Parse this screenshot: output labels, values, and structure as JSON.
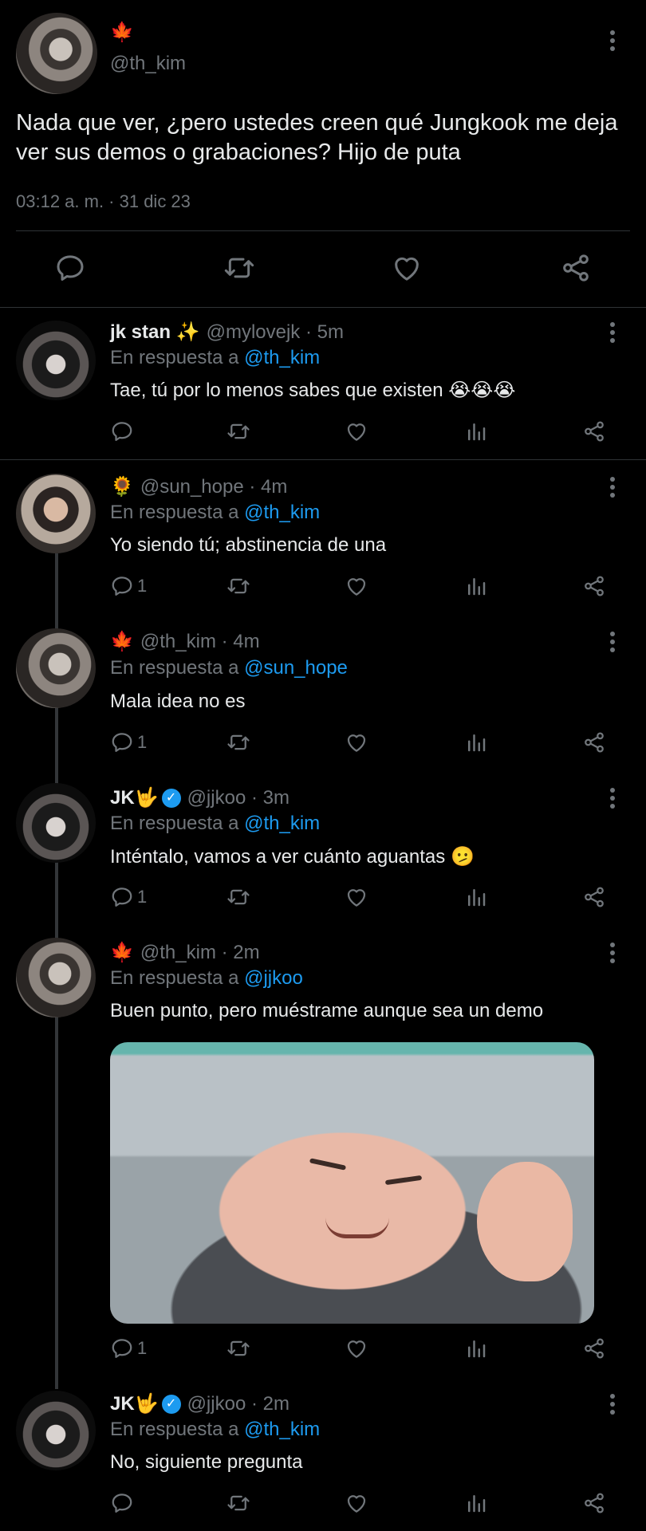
{
  "main_tweet": {
    "author_emoji": "🍁",
    "handle": "@th_kim",
    "text": "Nada que ver, ¿pero ustedes creen qué Jungkook me deja ver sus demos o grabaciones? Hijo de puta",
    "timestamp": "03:12 a. m. · 31 dic 23"
  },
  "replies": [
    {
      "name": "jk stan ✨",
      "handle": "@mylovejk · 5m",
      "reply_prefix": "En respuesta a",
      "reply_to": "@th_kim",
      "text": "Tae, tú por lo menos sabes que existen 😭😭😭",
      "reply_count": ""
    },
    {
      "emoji": "🌻",
      "handle": "@sun_hope · 4m",
      "reply_prefix": "En respuesta a",
      "reply_to": "@th_kim",
      "text": "Yo siendo tú; abstinencia de una",
      "reply_count": "1"
    },
    {
      "emoji": "🍁",
      "handle": "@th_kim · 4m",
      "reply_prefix": "En respuesta a",
      "reply_to": "@sun_hope",
      "text": "Mala idea no es",
      "reply_count": "1"
    },
    {
      "name": "JK🤟",
      "verified_mark": "✓",
      "handle": "@jjkoo · 3m",
      "reply_prefix": "En respuesta a",
      "reply_to": "@th_kim",
      "text": "Inténtalo, vamos a ver cuánto aguantas 🫤",
      "reply_count": "1"
    },
    {
      "emoji": "🍁",
      "handle": "@th_kim · 2m",
      "reply_prefix": "En respuesta a",
      "reply_to": "@jjkoo",
      "text": "Buen punto, pero muéstrame aunque sea un demo",
      "reply_count": "1"
    },
    {
      "name": "JK🤟",
      "verified_mark": "✓",
      "handle": "@jjkoo · 2m",
      "reply_prefix": "En respuesta a",
      "reply_to": "@th_kim",
      "text": "No, siguiente pregunta",
      "reply_count": ""
    }
  ],
  "colors": {
    "background": "#000000",
    "text": "#e7e9ea",
    "muted": "#71767b",
    "link": "#1d9bf0",
    "divider": "#2f3336"
  },
  "icons": [
    "reply-icon",
    "retweet-icon",
    "like-icon",
    "views-icon",
    "share-icon",
    "more-options-icon",
    "verified-badge-icon"
  ]
}
